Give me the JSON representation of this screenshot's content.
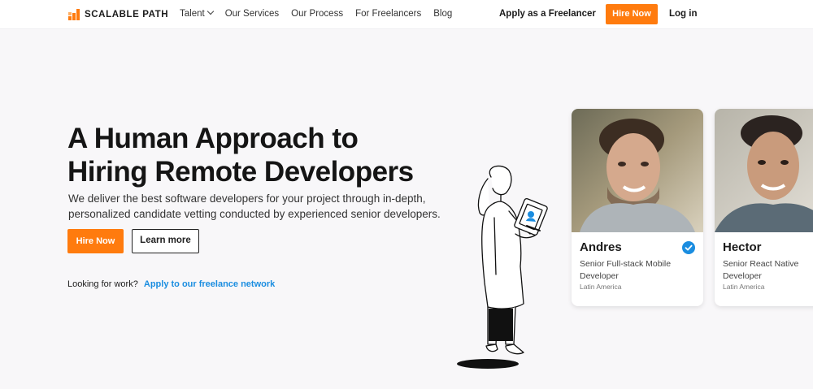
{
  "brand": {
    "name": "SCALABLE PATH",
    "accent": "#ff7b0e",
    "link_color": "#1a8de0"
  },
  "nav": {
    "items": [
      {
        "label": "Talent",
        "dropdown": true
      },
      {
        "label": "Our Services"
      },
      {
        "label": "Our Process"
      },
      {
        "label": "For Freelancers"
      },
      {
        "label": "Blog"
      }
    ],
    "apply": "Apply as a Freelancer",
    "hire": "Hire Now",
    "login": "Log in"
  },
  "hero": {
    "title_line1": "A Human Approach to",
    "title_line2": "Hiring Remote Developers",
    "subtitle_line1": "We deliver the best software developers for your project through in-depth,",
    "subtitle_line2": "personalized candidate vetting conducted by experienced senior developers.",
    "hire_button": "Hire Now",
    "learn_button": "Learn more",
    "looking_text": "Looking for work?",
    "looking_link": "Apply to our freelance network"
  },
  "developers": [
    {
      "name": "Andres",
      "role": "Senior Full-stack Mobile Developer",
      "location": "Latin America",
      "verified": true
    },
    {
      "name": "Hector",
      "role": "Senior React Native Developer",
      "location": "Latin America",
      "verified": false
    }
  ]
}
